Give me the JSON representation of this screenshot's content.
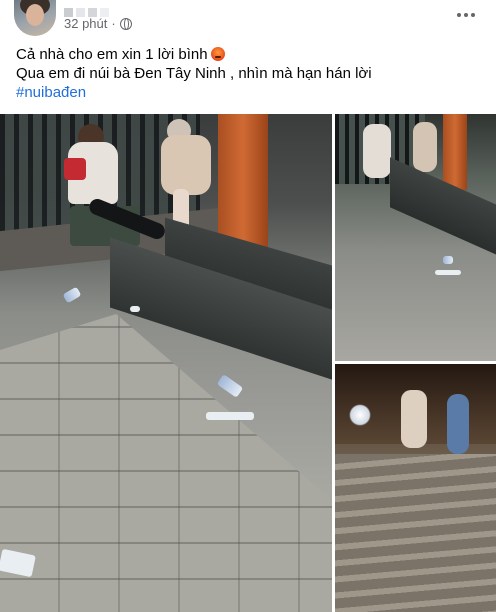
{
  "post": {
    "timestamp": "32 phút",
    "separator": "·",
    "privacy_icon": "globe-icon",
    "more_icon": "more-options-icon",
    "lines": [
      "Cả nhà cho em xin 1 lời bình",
      "Qua em đi núi bà Đen Tây Ninh , nhìn mà hạn hán lời"
    ],
    "emoji": "angry-face-icon",
    "hashtag": "#nuibađen"
  },
  "photos": [
    {
      "id": "photo-1",
      "subject": "steps with litter"
    },
    {
      "id": "photo-2",
      "subject": "steps top view"
    },
    {
      "id": "photo-3",
      "subject": "mountain stairs"
    }
  ],
  "colors": {
    "hashtag": "#216fdb",
    "meta_text": "#65676b",
    "body_text": "#050505"
  }
}
